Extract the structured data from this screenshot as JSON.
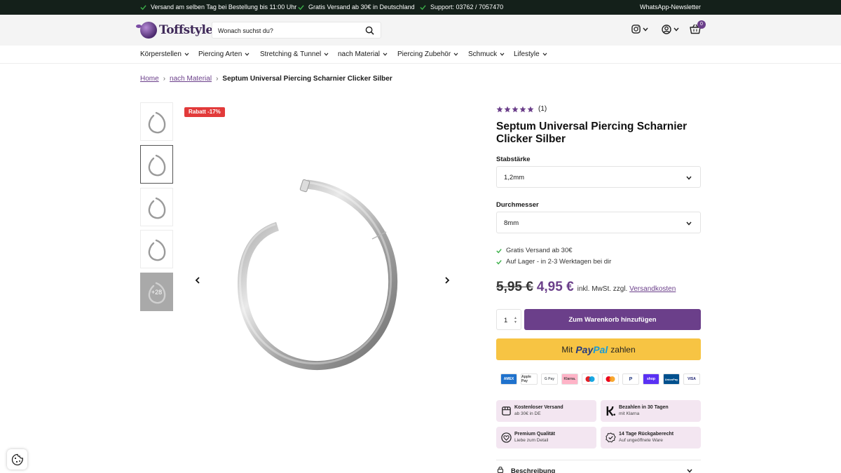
{
  "topbar": {
    "usp1": "Versand am selben Tag bei Bestellung bis 11:00 Uhr",
    "usp2": "Gratis Versand ab 30€ in Deutschland",
    "usp3": "Support: 03762 / 7057470",
    "newsletter": "WhatsApp-Newsletter"
  },
  "header": {
    "logo_text": "Toffstyle",
    "search_placeholder": "Wonach suchst du?",
    "cart_count": "0"
  },
  "nav": {
    "items": [
      "Körperstellen",
      "Piercing Arten",
      "Stretching & Tunnel",
      "nach Material",
      "Piercing Zubehör",
      "Schmuck",
      "Lifestyle"
    ]
  },
  "breadcrumb": {
    "home": "Home",
    "category": "nach Material",
    "current": "Septum Universal Piercing Scharnier Clicker Silber"
  },
  "gallery": {
    "sale_badge": "Rabatt -17%",
    "more_label": "+28"
  },
  "product": {
    "rating_stars": 5,
    "review_count": "(1)",
    "title": "Septum Universal Piercing Scharnier Clicker Silber",
    "option1_label": "Stabstärke",
    "option1_value": "1,2mm",
    "option2_label": "Durchmesser",
    "option2_value": "8mm",
    "usp_shipping": "Gratis Versand ab 30€",
    "usp_stock": "Auf Lager - in 2-3 Werktagen bei dir",
    "old_price": "5,95 €",
    "new_price": "4,95 €",
    "tax_text": "inkl. MwSt. zzgl.",
    "shipping_link": "Versandkosten",
    "quantity": "1",
    "add_to_cart": "Zum Warenkorb hinzufügen",
    "paypal_prefix": "Mit",
    "paypal_pay": "Pay",
    "paypal_pal": "Pal",
    "paypal_suffix": "zahlen"
  },
  "payment_methods": [
    "AMEX",
    "Apple Pay",
    "G Pay",
    "Klarna.",
    "Maestro",
    "Mastercard",
    "PayPal",
    "shop",
    "UnionPay",
    "VISA"
  ],
  "features": [
    {
      "title": "Kostenloser Versand",
      "sub": "ab 30€ in DE",
      "icon": "box-icon"
    },
    {
      "title": "Bezahlen in 30 Tagen",
      "sub": "mit Klarna",
      "icon": "klarna-icon"
    },
    {
      "title": "Premium Qualität",
      "sub": "Liebe zum Detail",
      "icon": "heart-icon"
    },
    {
      "title": "14 Tage Rückgaberecht",
      "sub": "Auf ungeöffnete Ware",
      "icon": "badge-check-icon"
    }
  ],
  "accordion": {
    "description_label": "Beschreibung"
  },
  "colors": {
    "brand_purple": "#6b3f8a",
    "topbar_bg": "#14201a",
    "paypal_yellow": "#f7c443",
    "sale_red": "#e23a3a",
    "feature_bg": "#f3e6f1",
    "check_green": "#3cb04a"
  }
}
